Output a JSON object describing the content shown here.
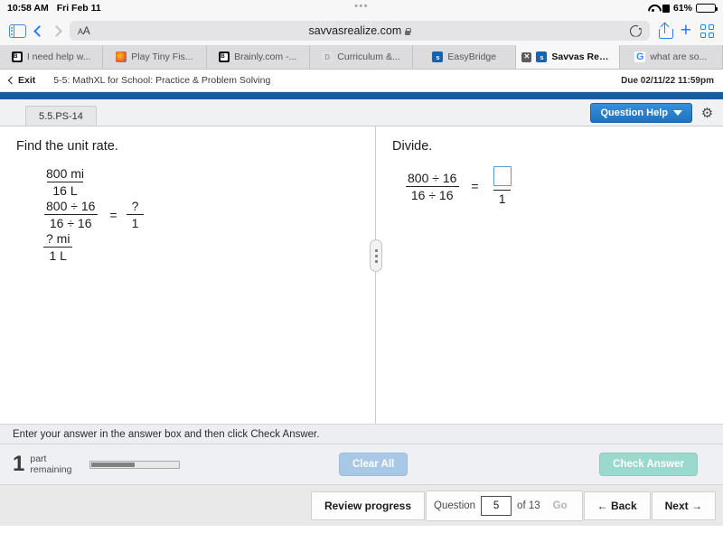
{
  "status_bar": {
    "time": "10:58 AM",
    "date": "Fri Feb 11",
    "dots": "•••",
    "battery_percent": "61%",
    "wifi_icon": "wifi-icon",
    "alarm_icon": "alarm-icon",
    "battery_icon": "battery-icon"
  },
  "browser": {
    "sidebar_icon": "sidebar-toggle-icon",
    "back_icon": "back-chevron-icon",
    "forward_icon": "forward-chevron-icon",
    "text_size_label": "AA",
    "url": "savvasrealize.com",
    "lock_icon": "lock-icon",
    "reload_icon": "reload-icon",
    "share_icon": "share-icon",
    "new_tab_icon": "plus-icon",
    "tabs_overview_icon": "tabs-grid-icon",
    "tabs": [
      {
        "label": "I need help w...",
        "favicon": "brainly-favicon",
        "favicon_letter": "B",
        "active": false
      },
      {
        "label": "Play Tiny Fis...",
        "favicon": "game-favicon",
        "favicon_letter": "",
        "active": false
      },
      {
        "label": "Brainly.com -...",
        "favicon": "brainly-favicon",
        "favicon_letter": "B",
        "active": false
      },
      {
        "label": "Curriculum &...",
        "favicon": "doc-favicon",
        "favicon_letter": "D",
        "active": false
      },
      {
        "label": "EasyBridge",
        "favicon": "savvas-favicon",
        "favicon_letter": "/s]",
        "active": false
      },
      {
        "label": "Savvas Realize",
        "favicon": "savvas-favicon",
        "favicon_letter": "/s]",
        "active": true,
        "close_icon": "✕"
      },
      {
        "label": "what are so...",
        "favicon": "google-favicon",
        "favicon_letter": "G",
        "active": false
      }
    ]
  },
  "app_bar": {
    "exit_label": "Exit",
    "exit_icon": "back-chevron-icon",
    "assignment_title": "5-5: MathXL for School: Practice & Problem Solving",
    "due_text": "Due 02/11/22 11:59pm"
  },
  "question_bar": {
    "question_tab_label": "5.5.PS-14",
    "question_help_label": "Question Help",
    "question_help_caret": "▼",
    "gear_icon": "gear-icon"
  },
  "left_pane": {
    "prompt": "Find the unit rate.",
    "fraction1": {
      "numerator": "800 mi",
      "denominator": "16 L"
    },
    "fraction2": {
      "numerator": "800 ÷ 16",
      "denominator": "16 ÷ 16"
    },
    "equals": "=",
    "fraction3": {
      "numerator": "?",
      "denominator": "1"
    },
    "fraction4": {
      "numerator": "? mi",
      "denominator": "1 L"
    }
  },
  "right_pane": {
    "prompt": "Divide.",
    "fraction1": {
      "numerator": "800 ÷ 16",
      "denominator": "16 ÷ 16"
    },
    "equals": "=",
    "answer_denominator": "1",
    "answer_value": "",
    "answer_placeholder": ""
  },
  "splitter": {
    "handle_icon": "splitter-grip-icon"
  },
  "instruction": {
    "text": "Enter your answer in the answer box and then click Check Answer."
  },
  "controls": {
    "remaining_count": "1",
    "remaining_line1": "part",
    "remaining_line2": "remaining",
    "progress_percent": 50,
    "clear_all_label": "Clear All",
    "check_answer_label": "Check Answer"
  },
  "bottom_nav": {
    "review_progress_label": "Review progress",
    "question_label": "Question",
    "question_number": "5",
    "of_label": "of 13",
    "go_label": "Go",
    "back_label": "Back",
    "back_icon": "arrow-left-icon",
    "next_label": "Next",
    "next_icon": "arrow-right-icon"
  },
  "colors": {
    "header_blue": "#1b5c9e",
    "button_blue": "#2f84cd",
    "answer_box_border": "#5b9bd5",
    "check_answer_green": "#9bd8cd",
    "clear_all_blue": "#a8c8e6"
  }
}
